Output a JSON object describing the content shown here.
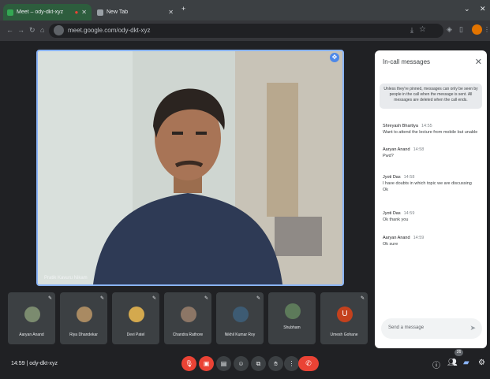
{
  "browser": {
    "tabs": [
      {
        "title": "Meet – ody-dkt-xyz",
        "recording": "●"
      },
      {
        "title": "New Tab"
      }
    ],
    "url": "meet.google.com/ody-dkt-xyz",
    "minimize": "⌄",
    "close": "✕"
  },
  "stage": {
    "speaker_name": "Pratik Kavuru Nikam",
    "pin_icon": "pin-icon"
  },
  "chat": {
    "title": "In-call messages",
    "close": "✕",
    "notice": "Unless they're pinned, messages can only be seen by people in the call when the message is sent. All messages are deleted when the call ends.",
    "messages": [
      {
        "sender": "Shreyash Bhartiya",
        "time": "14:55",
        "text": "Want to attend the lecture from mobile but unable"
      },
      {
        "sender": "Aaryan Anand",
        "time": "14:58",
        "text": "Pwd?"
      },
      {
        "sender": "Jyoti Das",
        "time": "14:58",
        "text": "I have doubts in which topic we are discussing"
      },
      {
        "sender": "",
        "time": "",
        "text": "Ok"
      },
      {
        "sender": "Jyoti Das",
        "time": "14:59",
        "text": "Ok thank you"
      },
      {
        "sender": "Aaryan Anand",
        "time": "14:59",
        "text": "Ok sure"
      }
    ],
    "input_placeholder": "Send a message",
    "send": "➤"
  },
  "participants": [
    {
      "name": "Aaryan Anand",
      "color": "#7b8b6f"
    },
    {
      "name": "Riya Dhandekar",
      "color": "#a98a62"
    },
    {
      "name": "Devi Patel",
      "color": "#d4a94e"
    },
    {
      "name": "Chandra Rathore",
      "color": "#8c7666"
    },
    {
      "name": "Nikhil Kumar Roy",
      "color": "#3d5b73"
    },
    {
      "name": "Shubham",
      "color": "#5d7a5a"
    },
    {
      "name": "Umesh Gohane",
      "color": "#c4411d",
      "initial": "U"
    }
  ],
  "bottom": {
    "time": "14:59",
    "meeting_code": "ody-dkt-xyz",
    "end_call": "✆",
    "badge": "26"
  },
  "colors": {
    "accent": "#8ab4f8",
    "danger": "#ea4335",
    "background": "#202124"
  }
}
